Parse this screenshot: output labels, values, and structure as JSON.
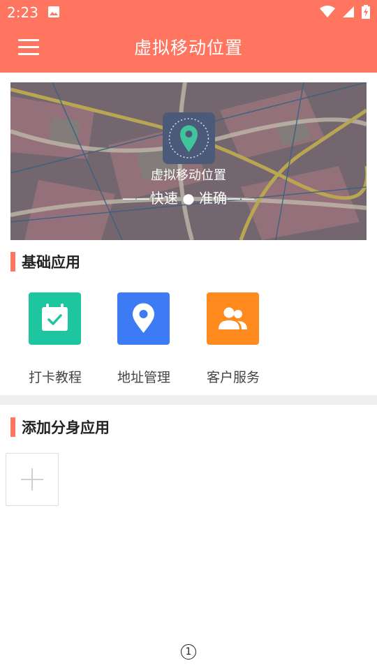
{
  "status_bar": {
    "time": "2:23",
    "icons": [
      "image-icon",
      "wifi-icon",
      "signal-icon",
      "battery-charging-icon"
    ]
  },
  "app_bar": {
    "title": "虚拟移动位置",
    "menu_icon": "menu-icon"
  },
  "banner": {
    "title": "虚拟移动位置",
    "tagline": "——快速 ● 准确——",
    "logo_icon": "location-pin-icon"
  },
  "basic_section": {
    "title": "基础应用",
    "items": [
      {
        "label": "打卡教程",
        "icon": "calendar-check-icon",
        "color": "#1ec6a0"
      },
      {
        "label": "地址管理",
        "icon": "location-pin-icon",
        "color": "#3c7bf4"
      },
      {
        "label": "客户服务",
        "icon": "users-icon",
        "color": "#ff8a1e"
      }
    ]
  },
  "clone_section": {
    "title": "添加分身应用",
    "add_icon": "plus-icon"
  },
  "bottom_indicator": "1",
  "colors": {
    "accent": "#ff7560",
    "divider": "#efefef"
  }
}
